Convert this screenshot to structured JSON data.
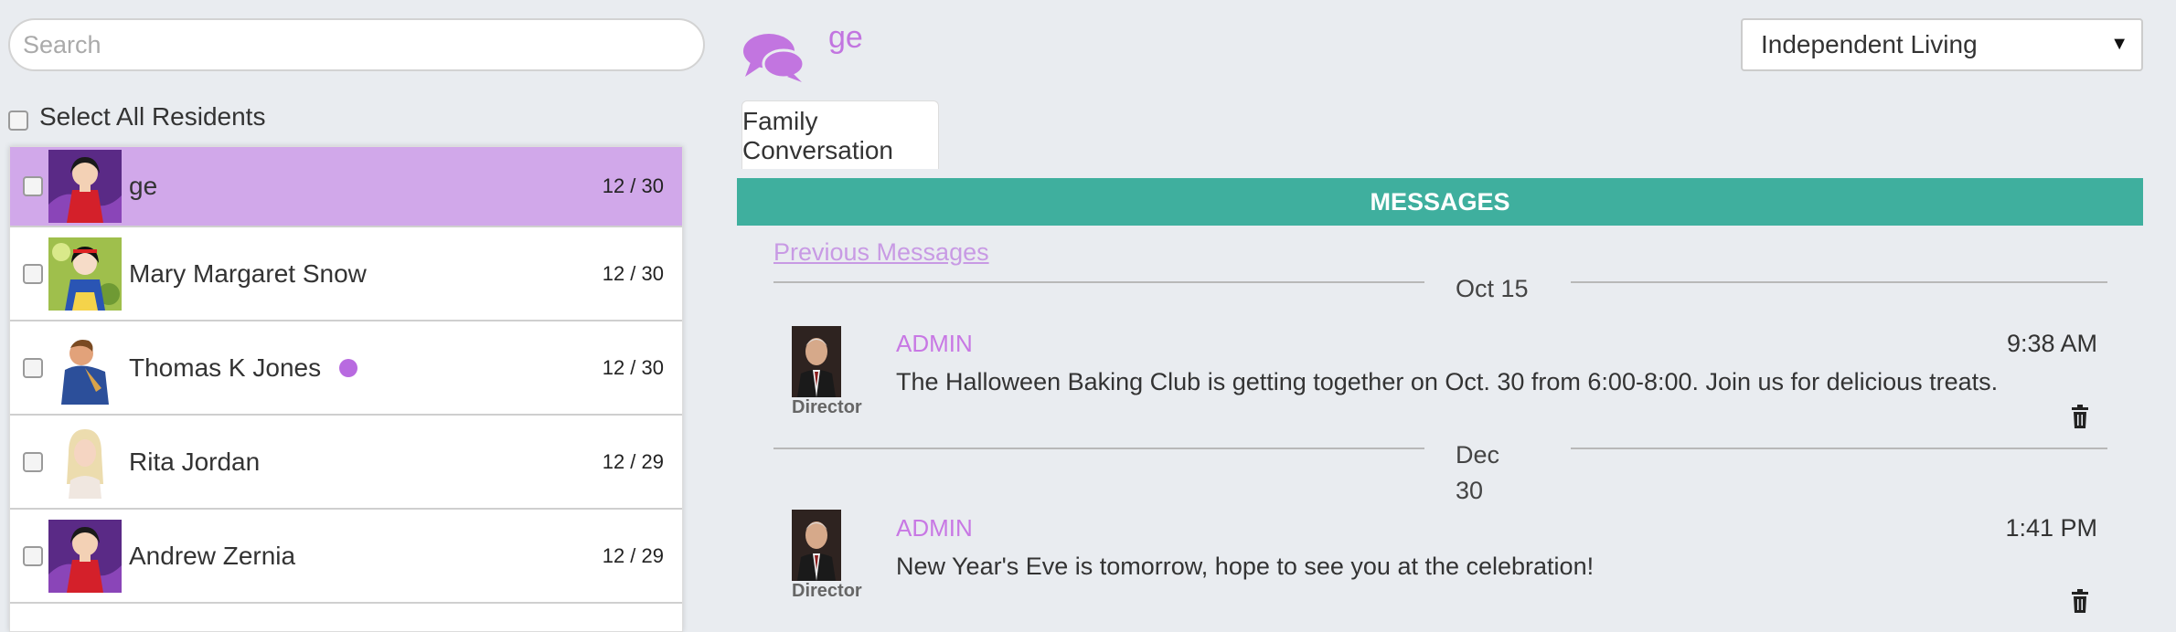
{
  "search": {
    "placeholder": "Search",
    "value": ""
  },
  "select_all": {
    "label": "Select All Residents"
  },
  "residents": [
    {
      "name": "ge",
      "count": "12 / 30",
      "selected": true,
      "online": false
    },
    {
      "name": "Mary Margaret Snow",
      "count": "12 / 30",
      "selected": false,
      "online": false
    },
    {
      "name": "Thomas K Jones",
      "count": "12 / 30",
      "selected": false,
      "online": true
    },
    {
      "name": "Rita Jordan",
      "count": "12 / 29",
      "selected": false,
      "online": false
    },
    {
      "name": "Andrew Zernia",
      "count": "12 / 29",
      "selected": false,
      "online": false
    }
  ],
  "header": {
    "current_resident": "ge",
    "icon": "chat-bubbles-icon"
  },
  "community_select": {
    "value": "Independent Living"
  },
  "tabs": [
    {
      "label": "Family Conversation",
      "active": true
    }
  ],
  "messages_panel": {
    "title": "MESSAGES",
    "previous_link": "Previous Messages",
    "groups": [
      {
        "date": "Oct 15",
        "messages": [
          {
            "sender": "ADMIN",
            "role": "Director",
            "time": "9:38 AM",
            "text": "The Halloween Baking Club is getting together on Oct. 30 from 6:00-8:00. Join us for delicious treats."
          }
        ]
      },
      {
        "date_line1": "Dec",
        "date_line2": "30",
        "messages": [
          {
            "sender": "ADMIN",
            "role": "Director",
            "time": "1:41 PM",
            "text": "New Year's Eve is tomorrow, hope to see you at the celebration!"
          }
        ]
      }
    ]
  },
  "colors": {
    "accent_purple": "#c275e0",
    "selected_row": "#d1a8ea",
    "header_teal": "#3faf9e",
    "background": "#e9ecf0"
  }
}
